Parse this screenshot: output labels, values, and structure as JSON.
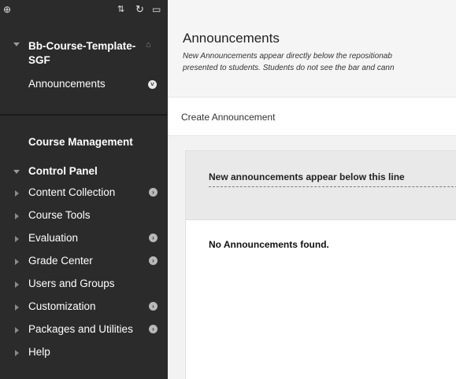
{
  "sidebar": {
    "toolbar": {
      "add_icon": "plus-circle-icon",
      "sort_icon": "sort-arrows-icon",
      "refresh_icon": "refresh-icon",
      "folder_icon": "folder-icon"
    },
    "course": {
      "title": "Bb-Course-Template-SGF",
      "links": [
        {
          "label": "Announcements"
        }
      ]
    },
    "course_management": {
      "heading": "Course Management",
      "control_panel": {
        "label": "Control Panel",
        "items": [
          {
            "label": "Content Collection",
            "has_menu": true
          },
          {
            "label": "Course Tools",
            "has_menu": false
          },
          {
            "label": "Evaluation",
            "has_menu": true
          },
          {
            "label": "Grade Center",
            "has_menu": true
          },
          {
            "label": "Users and Groups",
            "has_menu": false
          },
          {
            "label": "Customization",
            "has_menu": true
          },
          {
            "label": "Packages and Utilities",
            "has_menu": true
          },
          {
            "label": "Help",
            "has_menu": false
          }
        ]
      }
    }
  },
  "main": {
    "title": "Announcements",
    "description_line1": "New Announcements appear directly below the repositionab",
    "description_line2": "presented to students. Students do not see the bar and cann",
    "action_bar": {
      "create_label": "Create Announcement"
    },
    "reposition_bar_text": "New announcements appear below this line",
    "empty_message": "No Announcements found."
  }
}
